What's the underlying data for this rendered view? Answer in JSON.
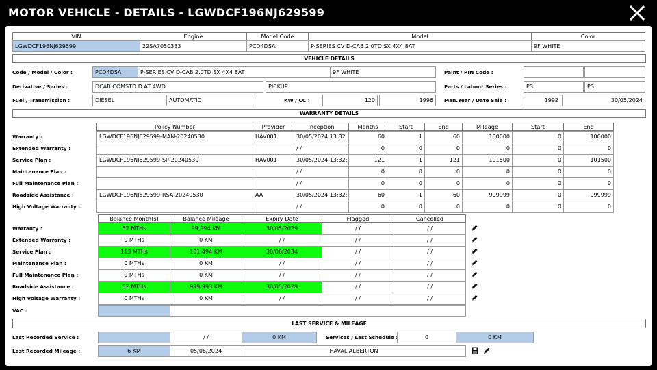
{
  "window": {
    "title": "MOTOR VEHICLE - DETAILS - LGWDCF196NJ629599"
  },
  "top_table": {
    "headers": {
      "vin": "VIN",
      "engine": "Engine",
      "model_code": "Model Code",
      "model": "Model",
      "color": "Color"
    },
    "values": {
      "vin": "LGWDCF196NJ629599",
      "engine": "22SA7050333",
      "model_code": "PCD4DSA",
      "model": "P-SERIES CV D-CAB 2.0TD SX 4X4 8AT",
      "color": "9F WHITE"
    }
  },
  "vehicle_details": {
    "section_title": "VEHICLE DETAILS",
    "labels": {
      "code_model_color": "Code / Model / Color :",
      "derivative_series": "Derivative / Series :",
      "fuel_transmission": "Fuel / Transmission :",
      "paint_pin": "Paint / PIN Code :",
      "parts_labour": "Parts / Labour Series :",
      "kw_cc": "KW / CC :",
      "man_year_date_sale": "Man.Year / Date Sale :"
    },
    "values": {
      "code": "PCD4DSA",
      "model": "P-SERIES CV D-CAB 2.0TD SX 4X4 8AT",
      "color": "9F WHITE",
      "derivative": "DCAB COMSTD D AT 4WD",
      "series": "PICKUP",
      "fuel": "DIESEL",
      "transmission": "AUTOMATIC",
      "paint": "",
      "pin": "",
      "parts_series": "PS",
      "labour_series": "PS",
      "kw": "120",
      "cc": "1996",
      "man_year": "1992",
      "date_sale": "30/05/2024"
    }
  },
  "warranty_details": {
    "section_title": "WARRANTY DETAILS",
    "headers": [
      "Policy Number",
      "Provider",
      "Inception",
      "Months",
      "Start",
      "End",
      "Mileage",
      "Start",
      "End"
    ],
    "rows": [
      {
        "label": "Warranty :",
        "policy": "LGWDCF196NJ629599-MAN-20240530",
        "provider": "HAV001",
        "inception": "30/05/2024 13:32:",
        "months": "60",
        "start": "1",
        "end": "60",
        "mileage": "100000",
        "mstart": "0",
        "mend": "100000"
      },
      {
        "label": "Extended Warranty :",
        "policy": "",
        "provider": "",
        "inception": " / /",
        "months": "0",
        "start": "0",
        "end": "0",
        "mileage": "0",
        "mstart": "0",
        "mend": "0"
      },
      {
        "label": "Service Plan :",
        "policy": "LGWDCF196NJ629599-SP-20240530",
        "provider": "HAV001",
        "inception": "30/05/2024 13:32:",
        "months": "121",
        "start": "1",
        "end": "121",
        "mileage": "101500",
        "mstart": "0",
        "mend": "101500"
      },
      {
        "label": "Maintenance Plan :",
        "policy": "",
        "provider": "",
        "inception": " / /",
        "months": "0",
        "start": "0",
        "end": "0",
        "mileage": "0",
        "mstart": "0",
        "mend": "0"
      },
      {
        "label": "Full Maintenance Plan :",
        "policy": "",
        "provider": "",
        "inception": " / /",
        "months": "0",
        "start": "0",
        "end": "0",
        "mileage": "0",
        "mstart": "0",
        "mend": "0"
      },
      {
        "label": "Roadside Assistance :",
        "policy": "LGWDCF196NJ629599-RSA-20240530",
        "provider": "AA",
        "inception": "30/05/2024 13:32:",
        "months": "60",
        "start": "1",
        "end": "60",
        "mileage": "999999",
        "mstart": "0",
        "mend": "999999"
      },
      {
        "label": "High Voltage Warranty :",
        "policy": "",
        "provider": "",
        "inception": " / /",
        "months": "0",
        "start": "0",
        "end": "0",
        "mileage": "0",
        "mstart": "0",
        "mend": "0"
      }
    ]
  },
  "balances": {
    "headers": [
      "Balance Month(s)",
      "Balance Mileage",
      "Expiry Date",
      "Flagged",
      "Cancelled"
    ],
    "rows": [
      {
        "label": "Warranty :",
        "months": "52 MTHs",
        "mileage": "99,994 KM",
        "expiry": "30/05/2029",
        "flagged": " / /",
        "cancelled": " / /",
        "active": true
      },
      {
        "label": "Extended Warranty :",
        "months": "0 MTHs",
        "mileage": "0 KM",
        "expiry": " / /",
        "flagged": " / /",
        "cancelled": " / /",
        "active": false
      },
      {
        "label": "Service Plan :",
        "months": "113 MTHs",
        "mileage": "101,494 KM",
        "expiry": "30/06/2034",
        "flagged": " / /",
        "cancelled": " / /",
        "active": true
      },
      {
        "label": "Maintenance Plan :",
        "months": "0 MTHs",
        "mileage": "0 KM",
        "expiry": " / /",
        "flagged": " / /",
        "cancelled": " / /",
        "active": false
      },
      {
        "label": "Full Maintenance Plan :",
        "months": "0 MTHs",
        "mileage": "0 KM",
        "expiry": " / /",
        "flagged": " / /",
        "cancelled": " / /",
        "active": false
      },
      {
        "label": "Roadside Assistance :",
        "months": "52 MTHs",
        "mileage": "999,993 KM",
        "expiry": "30/05/2029",
        "flagged": " / /",
        "cancelled": " / /",
        "active": true
      },
      {
        "label": "High Voltage Warranty :",
        "months": "0 MTHs",
        "mileage": "0 KM",
        "expiry": " / /",
        "flagged": " / /",
        "cancelled": " / /",
        "active": false
      }
    ],
    "vac_label": "VAC :",
    "vac_value": ""
  },
  "last_service": {
    "section_title": "LAST SERVICE & MILEAGE",
    "last_recorded_service_label": "Last Recorded Service :",
    "last_recorded_service_value": "",
    "last_service_date": " / /",
    "last_service_km": "0 KM",
    "services_schedule_label": "Services / Last Schedule :",
    "services_count": "0",
    "schedule_km": "0 KM",
    "last_recorded_mileage_label": "Last Recorded Mileage :",
    "last_mileage_km": "6 KM",
    "last_mileage_date": "05/06/2024",
    "dealer": "HAVAL ALBERTON"
  },
  "colors": {
    "active_green": "#0dfb0d",
    "field_blue": "#b3cde8"
  },
  "icons": {
    "close": "close-icon",
    "edit": "pencil-icon",
    "save": "save-icon"
  }
}
